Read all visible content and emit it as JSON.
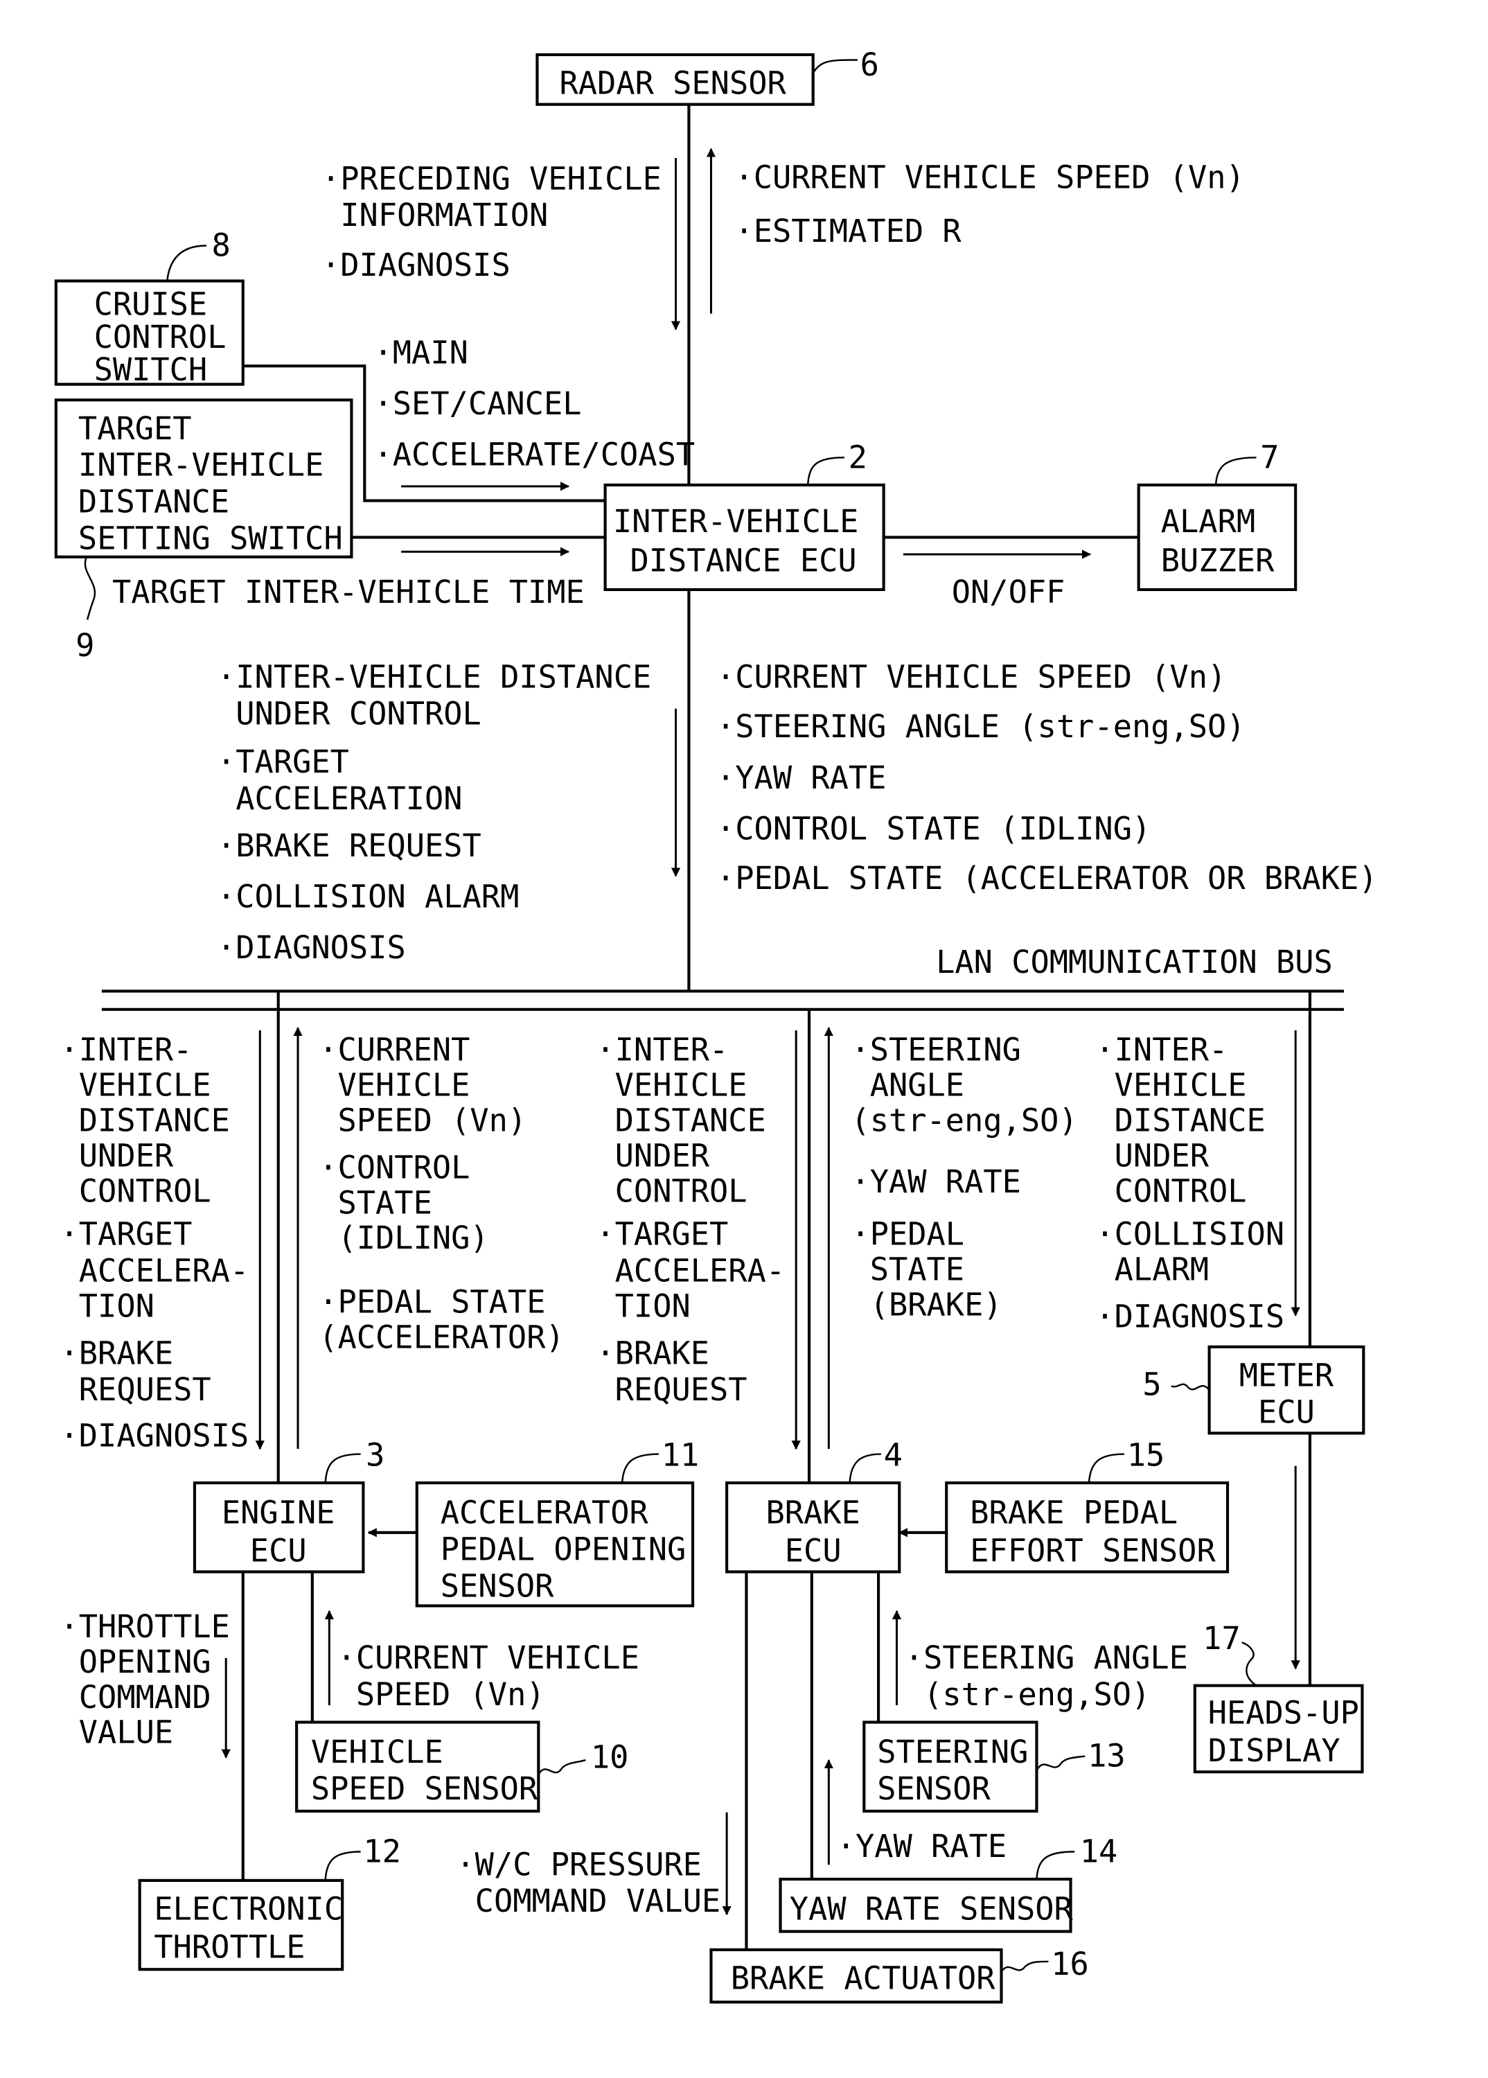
{
  "figure": {
    "blocks": {
      "radar_sensor": {
        "label": [
          "RADAR SENSOR"
        ],
        "ref": "6"
      },
      "cruise_switch": {
        "label": [
          "CRUISE",
          "CONTROL",
          "SWITCH"
        ],
        "ref": "8"
      },
      "distance_switch": {
        "label": [
          "TARGET",
          "INTER-VEHICLE",
          "DISTANCE",
          "SETTING SWITCH"
        ],
        "ref": "9"
      },
      "distance_ecu": {
        "label": [
          "INTER-VEHICLE",
          "DISTANCE ECU"
        ],
        "ref": "2"
      },
      "alarm_buzzer": {
        "label": [
          "ALARM",
          "BUZZER"
        ],
        "ref": "7"
      },
      "engine_ecu": {
        "label": [
          "ENGINE",
          "ECU"
        ],
        "ref": "3"
      },
      "accel_sensor": {
        "label": [
          "ACCELERATOR",
          "PEDAL OPENING",
          "SENSOR"
        ],
        "ref": "11"
      },
      "brake_ecu": {
        "label": [
          "BRAKE",
          "ECU"
        ],
        "ref": "4"
      },
      "brake_pedal_sensor": {
        "label": [
          "BRAKE PEDAL",
          "EFFORT SENSOR"
        ],
        "ref": "15"
      },
      "meter_ecu": {
        "label": [
          "METER",
          "ECU"
        ],
        "ref": "5"
      },
      "hud": {
        "label": [
          "HEADS-UP",
          "DISPLAY"
        ],
        "ref": "17"
      },
      "vehicle_speed_sensor": {
        "label": [
          "VEHICLE",
          "SPEED SENSOR"
        ],
        "ref": "10"
      },
      "electronic_throttle": {
        "label": [
          "ELECTRONIC",
          "THROTTLE"
        ],
        "ref": "12"
      },
      "steering_sensor": {
        "label": [
          "STEERING",
          "SENSOR"
        ],
        "ref": "13"
      },
      "yaw_rate_sensor": {
        "label": [
          "YAW RATE SENSOR"
        ],
        "ref": "14"
      },
      "brake_actuator": {
        "label": [
          "BRAKE ACTUATOR"
        ],
        "ref": "16"
      }
    },
    "signals": {
      "radar_down": [
        "·PRECEDING VEHICLE",
        " INFORMATION",
        "·DIAGNOSIS"
      ],
      "radar_up": [
        "·CURRENT VEHICLE SPEED (Vn)",
        "·ESTIMATED R"
      ],
      "cruise": [
        "·MAIN",
        "·SET/CANCEL",
        "·ACCELERATE/COAST"
      ],
      "target_time": "TARGET INTER-VEHICLE TIME",
      "alarm": "ON/OFF",
      "ecu_down": [
        "·INTER-VEHICLE DISTANCE",
        " UNDER CONTROL",
        "·TARGET",
        " ACCELERATION",
        "·BRAKE REQUEST",
        "·COLLISION ALARM",
        "·DIAGNOSIS"
      ],
      "ecu_up": [
        "·CURRENT VEHICLE SPEED (Vn)",
        "·STEERING ANGLE (str-eng,SO)",
        "·YAW RATE",
        "·CONTROL STATE (IDLING)",
        "·PEDAL STATE (ACCELERATOR OR BRAKE)"
      ],
      "bus_label": "LAN COMMUNICATION BUS",
      "engine_down": [
        "·INTER-",
        " VEHICLE",
        " DISTANCE",
        " UNDER",
        " CONTROL",
        "·TARGET",
        " ACCELERA-",
        " TION",
        "·BRAKE",
        " REQUEST",
        "·DIAGNOSIS"
      ],
      "engine_up": [
        "·CURRENT",
        " VEHICLE",
        " SPEED (Vn)",
        "·CONTROL",
        " STATE",
        " (IDLING)",
        "·PEDAL STATE",
        "(ACCELERATOR)"
      ],
      "brake_down": [
        "·INTER-",
        " VEHICLE",
        " DISTANCE",
        " UNDER",
        " CONTROL",
        "·TARGET",
        " ACCELERA-",
        " TION",
        "·BRAKE",
        " REQUEST"
      ],
      "brake_up": [
        "·STEERING",
        " ANGLE",
        "(str-eng,SO)",
        "·YAW RATE",
        "·PEDAL",
        " STATE",
        " (BRAKE)"
      ],
      "meter_down": [
        "·INTER-",
        " VEHICLE",
        " DISTANCE",
        " UNDER",
        " CONTROL",
        "·COLLISION",
        " ALARM",
        "·DIAGNOSIS"
      ],
      "throttle": [
        "·THROTTLE",
        " OPENING",
        " COMMAND",
        " VALUE"
      ],
      "speed_sensor": [
        "·CURRENT VEHICLE",
        " SPEED (Vn)"
      ],
      "steering": [
        "·STEERING ANGLE",
        " (str-eng,SO)"
      ],
      "yaw": "·YAW RATE",
      "wc_pressure": [
        "·W/C PRESSURE",
        " COMMAND VALUE"
      ]
    }
  }
}
